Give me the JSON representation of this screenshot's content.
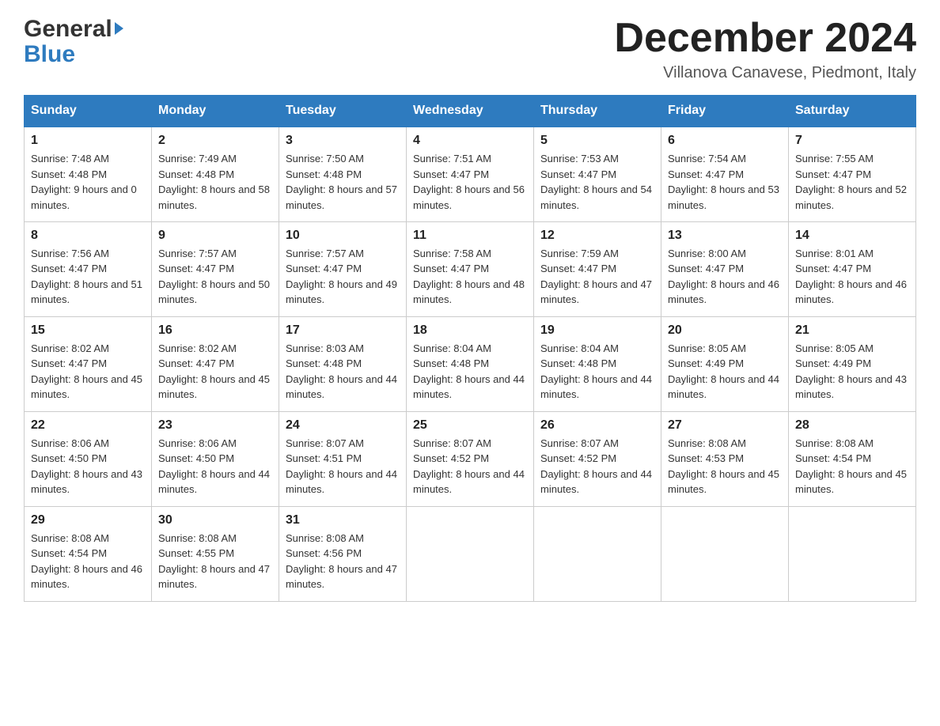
{
  "header": {
    "month_title": "December 2024",
    "location": "Villanova Canavese, Piedmont, Italy",
    "logo_general": "General",
    "logo_blue": "Blue"
  },
  "days_of_week": [
    "Sunday",
    "Monday",
    "Tuesday",
    "Wednesday",
    "Thursday",
    "Friday",
    "Saturday"
  ],
  "weeks": [
    [
      {
        "day": "1",
        "sunrise": "7:48 AM",
        "sunset": "4:48 PM",
        "daylight": "9 hours and 0 minutes."
      },
      {
        "day": "2",
        "sunrise": "7:49 AM",
        "sunset": "4:48 PM",
        "daylight": "8 hours and 58 minutes."
      },
      {
        "day": "3",
        "sunrise": "7:50 AM",
        "sunset": "4:48 PM",
        "daylight": "8 hours and 57 minutes."
      },
      {
        "day": "4",
        "sunrise": "7:51 AM",
        "sunset": "4:47 PM",
        "daylight": "8 hours and 56 minutes."
      },
      {
        "day": "5",
        "sunrise": "7:53 AM",
        "sunset": "4:47 PM",
        "daylight": "8 hours and 54 minutes."
      },
      {
        "day": "6",
        "sunrise": "7:54 AM",
        "sunset": "4:47 PM",
        "daylight": "8 hours and 53 minutes."
      },
      {
        "day": "7",
        "sunrise": "7:55 AM",
        "sunset": "4:47 PM",
        "daylight": "8 hours and 52 minutes."
      }
    ],
    [
      {
        "day": "8",
        "sunrise": "7:56 AM",
        "sunset": "4:47 PM",
        "daylight": "8 hours and 51 minutes."
      },
      {
        "day": "9",
        "sunrise": "7:57 AM",
        "sunset": "4:47 PM",
        "daylight": "8 hours and 50 minutes."
      },
      {
        "day": "10",
        "sunrise": "7:57 AM",
        "sunset": "4:47 PM",
        "daylight": "8 hours and 49 minutes."
      },
      {
        "day": "11",
        "sunrise": "7:58 AM",
        "sunset": "4:47 PM",
        "daylight": "8 hours and 48 minutes."
      },
      {
        "day": "12",
        "sunrise": "7:59 AM",
        "sunset": "4:47 PM",
        "daylight": "8 hours and 47 minutes."
      },
      {
        "day": "13",
        "sunrise": "8:00 AM",
        "sunset": "4:47 PM",
        "daylight": "8 hours and 46 minutes."
      },
      {
        "day": "14",
        "sunrise": "8:01 AM",
        "sunset": "4:47 PM",
        "daylight": "8 hours and 46 minutes."
      }
    ],
    [
      {
        "day": "15",
        "sunrise": "8:02 AM",
        "sunset": "4:47 PM",
        "daylight": "8 hours and 45 minutes."
      },
      {
        "day": "16",
        "sunrise": "8:02 AM",
        "sunset": "4:47 PM",
        "daylight": "8 hours and 45 minutes."
      },
      {
        "day": "17",
        "sunrise": "8:03 AM",
        "sunset": "4:48 PM",
        "daylight": "8 hours and 44 minutes."
      },
      {
        "day": "18",
        "sunrise": "8:04 AM",
        "sunset": "4:48 PM",
        "daylight": "8 hours and 44 minutes."
      },
      {
        "day": "19",
        "sunrise": "8:04 AM",
        "sunset": "4:48 PM",
        "daylight": "8 hours and 44 minutes."
      },
      {
        "day": "20",
        "sunrise": "8:05 AM",
        "sunset": "4:49 PM",
        "daylight": "8 hours and 44 minutes."
      },
      {
        "day": "21",
        "sunrise": "8:05 AM",
        "sunset": "4:49 PM",
        "daylight": "8 hours and 43 minutes."
      }
    ],
    [
      {
        "day": "22",
        "sunrise": "8:06 AM",
        "sunset": "4:50 PM",
        "daylight": "8 hours and 43 minutes."
      },
      {
        "day": "23",
        "sunrise": "8:06 AM",
        "sunset": "4:50 PM",
        "daylight": "8 hours and 44 minutes."
      },
      {
        "day": "24",
        "sunrise": "8:07 AM",
        "sunset": "4:51 PM",
        "daylight": "8 hours and 44 minutes."
      },
      {
        "day": "25",
        "sunrise": "8:07 AM",
        "sunset": "4:52 PM",
        "daylight": "8 hours and 44 minutes."
      },
      {
        "day": "26",
        "sunrise": "8:07 AM",
        "sunset": "4:52 PM",
        "daylight": "8 hours and 44 minutes."
      },
      {
        "day": "27",
        "sunrise": "8:08 AM",
        "sunset": "4:53 PM",
        "daylight": "8 hours and 45 minutes."
      },
      {
        "day": "28",
        "sunrise": "8:08 AM",
        "sunset": "4:54 PM",
        "daylight": "8 hours and 45 minutes."
      }
    ],
    [
      {
        "day": "29",
        "sunrise": "8:08 AM",
        "sunset": "4:54 PM",
        "daylight": "8 hours and 46 minutes."
      },
      {
        "day": "30",
        "sunrise": "8:08 AM",
        "sunset": "4:55 PM",
        "daylight": "8 hours and 47 minutes."
      },
      {
        "day": "31",
        "sunrise": "8:08 AM",
        "sunset": "4:56 PM",
        "daylight": "8 hours and 47 minutes."
      },
      null,
      null,
      null,
      null
    ]
  ]
}
